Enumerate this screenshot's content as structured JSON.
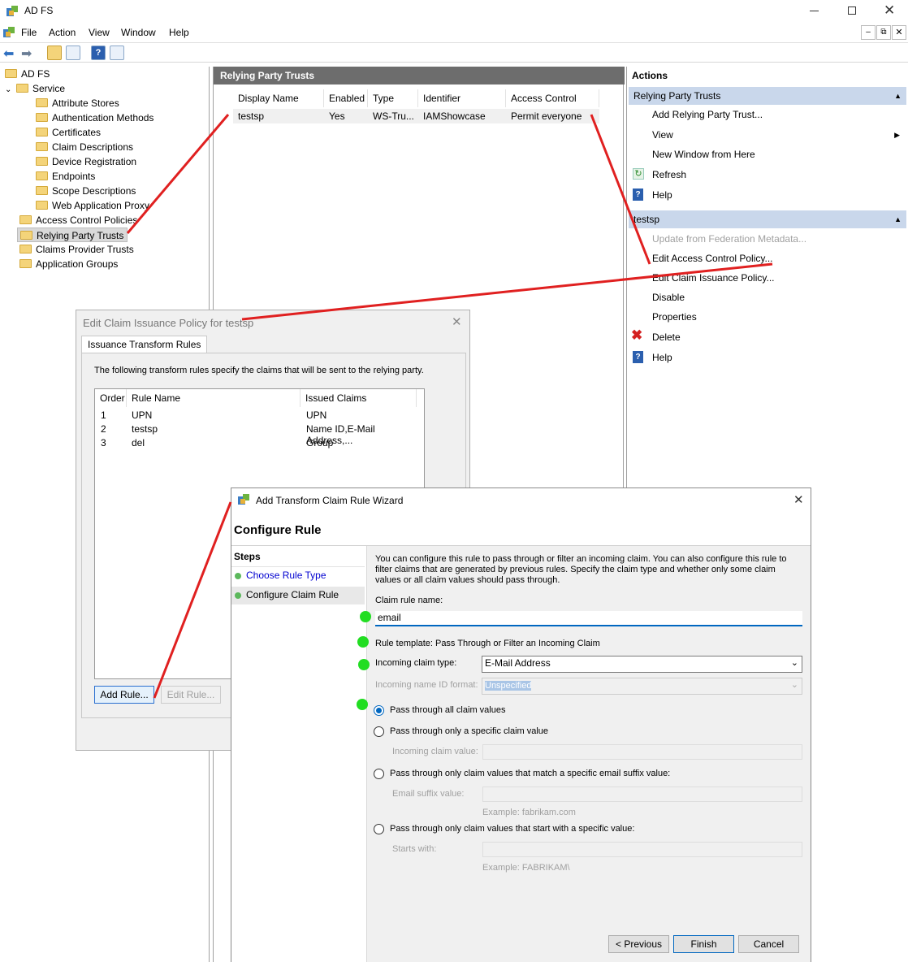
{
  "window": {
    "title": "AD FS"
  },
  "menu": [
    "File",
    "Action",
    "View",
    "Window",
    "Help"
  ],
  "tree": {
    "root": "AD FS",
    "service": "Service",
    "service_children": [
      "Attribute Stores",
      "Authentication Methods",
      "Certificates",
      "Claim Descriptions",
      "Device Registration",
      "Endpoints",
      "Scope Descriptions",
      "Web Application Proxy"
    ],
    "top_items": [
      "Access Control Policies",
      "Relying Party Trusts",
      "Claims Provider Trusts",
      "Application Groups"
    ]
  },
  "center": {
    "title": "Relying Party Trusts",
    "columns": [
      "Display Name",
      "Enabled",
      "Type",
      "Identifier",
      "Access Control Policy"
    ],
    "rows": [
      [
        "testsp",
        "Yes",
        "WS-Tru...",
        "IAMShowcase",
        "Permit everyone"
      ]
    ]
  },
  "actions": {
    "title": "Actions",
    "section1": "Relying Party Trusts",
    "items1": [
      "Add Relying Party Trust...",
      "View",
      "New Window from Here",
      "Refresh",
      "Help"
    ],
    "section2": "testsp",
    "items2": [
      "Update from Federation Metadata...",
      "Edit Access Control Policy...",
      "Edit Claim Issuance Policy...",
      "Disable",
      "Properties",
      "Delete",
      "Help"
    ]
  },
  "claim_dialog": {
    "title": "Edit Claim Issuance Policy for testsp",
    "tab": "Issuance Transform Rules",
    "description": "The following transform rules specify the claims that will be sent to the relying party.",
    "columns": [
      "Order",
      "Rule Name",
      "Issued Claims"
    ],
    "rows": [
      [
        "1",
        "UPN",
        "UPN"
      ],
      [
        "2",
        "testsp",
        "Name ID,E-Mail Address,..."
      ],
      [
        "3",
        "del",
        "Group"
      ]
    ],
    "add_rule": "Add Rule...",
    "edit_rule": "Edit Rule..."
  },
  "wizard": {
    "title": "Add Transform Claim Rule Wizard",
    "heading": "Configure Rule",
    "steps_title": "Steps",
    "steps": [
      "Choose Rule Type",
      "Configure Claim Rule"
    ],
    "intro": "You can configure this rule to pass through or filter an incoming claim. You can also configure this rule to filter claims that are generated by previous rules. Specify the claim type and whether only some claim values or all claim values should pass through.",
    "rule_name_label": "Claim rule name:",
    "rule_name_value": "email",
    "template_label": "Rule template: Pass Through or Filter an Incoming Claim",
    "incoming_type_label": "Incoming claim type:",
    "incoming_type_value": "E-Mail Address",
    "name_id_label": "Incoming name ID format:",
    "name_id_value": "Unspecified",
    "options": [
      {
        "label": "Pass through all claim values",
        "selected": true
      },
      {
        "label": "Pass through only a specific claim value",
        "selected": false
      },
      {
        "label": "Pass through only claim values that match a specific email suffix value:",
        "selected": false
      },
      {
        "label": "Pass through only claim values that start with a specific value:",
        "selected": false
      }
    ],
    "incoming_value_label": "Incoming claim value:",
    "email_suffix_label": "Email suffix value:",
    "email_example": "Example: fabrikam.com",
    "starts_with_label": "Starts with:",
    "starts_example": "Example: FABRIKAM\\",
    "prev_button": "< Previous",
    "finish_button": "Finish",
    "cancel_button": "Cancel"
  },
  "colors": {
    "annotation_line": "#e02020",
    "marker_dot": "#22dd22",
    "section_header": "#c9d7eb"
  }
}
